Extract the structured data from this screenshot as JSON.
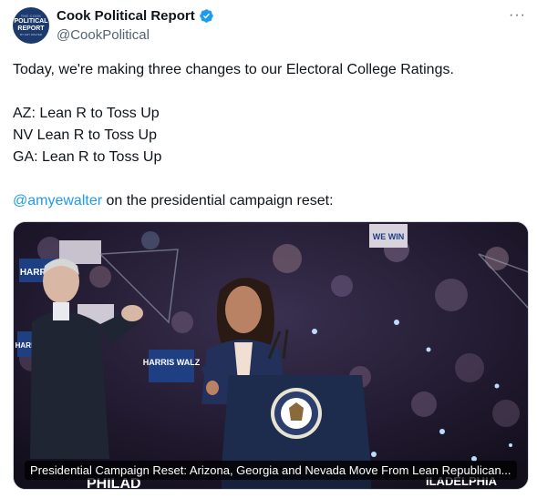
{
  "account": {
    "display_name": "Cook Political Report",
    "handle": "@CookPolitical",
    "avatar": {
      "line1": "THE COOK",
      "line2": "POLITICAL",
      "line3": "REPORT",
      "line4": "BY AMY WALTER"
    },
    "verified_icon": "verified-badge-icon",
    "more_icon": "more-options-icon"
  },
  "tweet": {
    "line1": "Today, we're making three changes to our Electoral College Ratings.",
    "changes": [
      "AZ: Lean R to Toss Up",
      "NV Lean R to Toss Up",
      "GA: Lean R to Toss Up"
    ],
    "mention": "@amyewalter",
    "after_mention": " on the presidential campaign reset:"
  },
  "media": {
    "caption": "Presidential Campaign Reset: Arizona, Georgia and Nevada Move From Lean Republican...",
    "signs": [
      "HARRIS",
      "HARRIS",
      "HARRIS WALZ",
      "WE WIN"
    ],
    "bottom_text_left": "PHILAD",
    "bottom_text_right": "ILADELPHIA"
  },
  "colors": {
    "link": "#1d9bf0",
    "verified": "#1d9bf0",
    "secondary": "#536471"
  }
}
